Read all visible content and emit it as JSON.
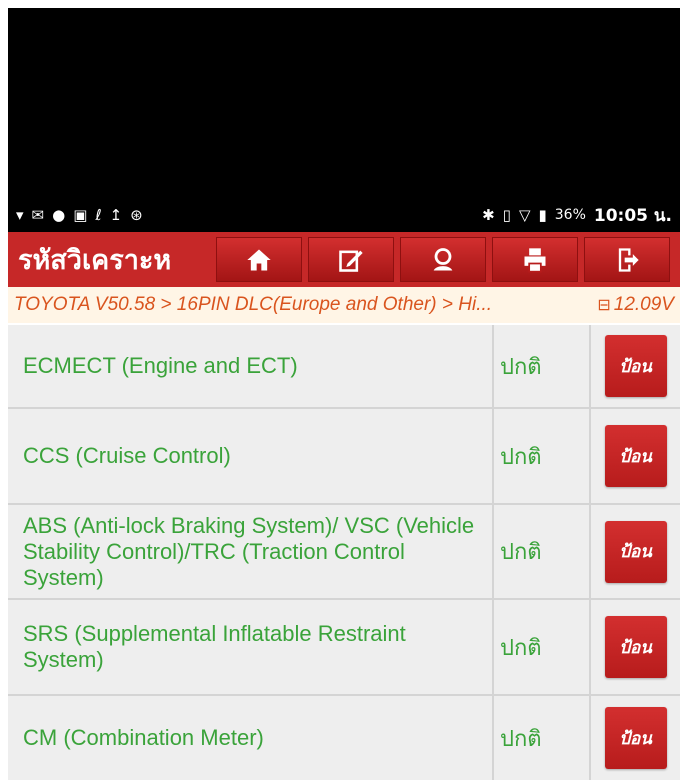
{
  "statusbar": {
    "left_icons": [
      "wifi-question-icon",
      "mail-icon",
      "chat-icon",
      "image-icon",
      "stethoscope-icon",
      "upload-icon",
      "bluetooth-circle-icon"
    ],
    "battery": "36%",
    "time": "10:05 น."
  },
  "toolbar": {
    "title": "รหัสวิเคราะห",
    "buttons": [
      "home-icon",
      "edit-icon",
      "support-icon",
      "print-icon",
      "exit-icon"
    ]
  },
  "breadcrumb": {
    "path": "TOYOTA V50.58 > 16PIN DLC(Europe and Other) > Hi...",
    "voltage": "12.09V"
  },
  "systems": [
    {
      "name": "ECMECT (Engine and ECT)",
      "status": "ปกติ",
      "button": "ป้อน"
    },
    {
      "name": "CCS (Cruise Control)",
      "status": "ปกติ",
      "button": "ป้อน"
    },
    {
      "name": "ABS (Anti-lock Braking System)/ VSC (Vehicle Stability Control)/TRC (Traction Control System)",
      "status": "ปกติ",
      "button": "ป้อน"
    },
    {
      "name": "SRS (Supplemental Inflatable Restraint System)",
      "status": "ปกติ",
      "button": "ป้อน"
    },
    {
      "name": "CM (Combination Meter)",
      "status": "ปกติ",
      "button": "ป้อน"
    }
  ],
  "colors": {
    "toolbar": "#c62828",
    "text_green": "#3aa33a",
    "breadcrumb_text": "#d9541e",
    "row_bg": "#eeeeee"
  }
}
